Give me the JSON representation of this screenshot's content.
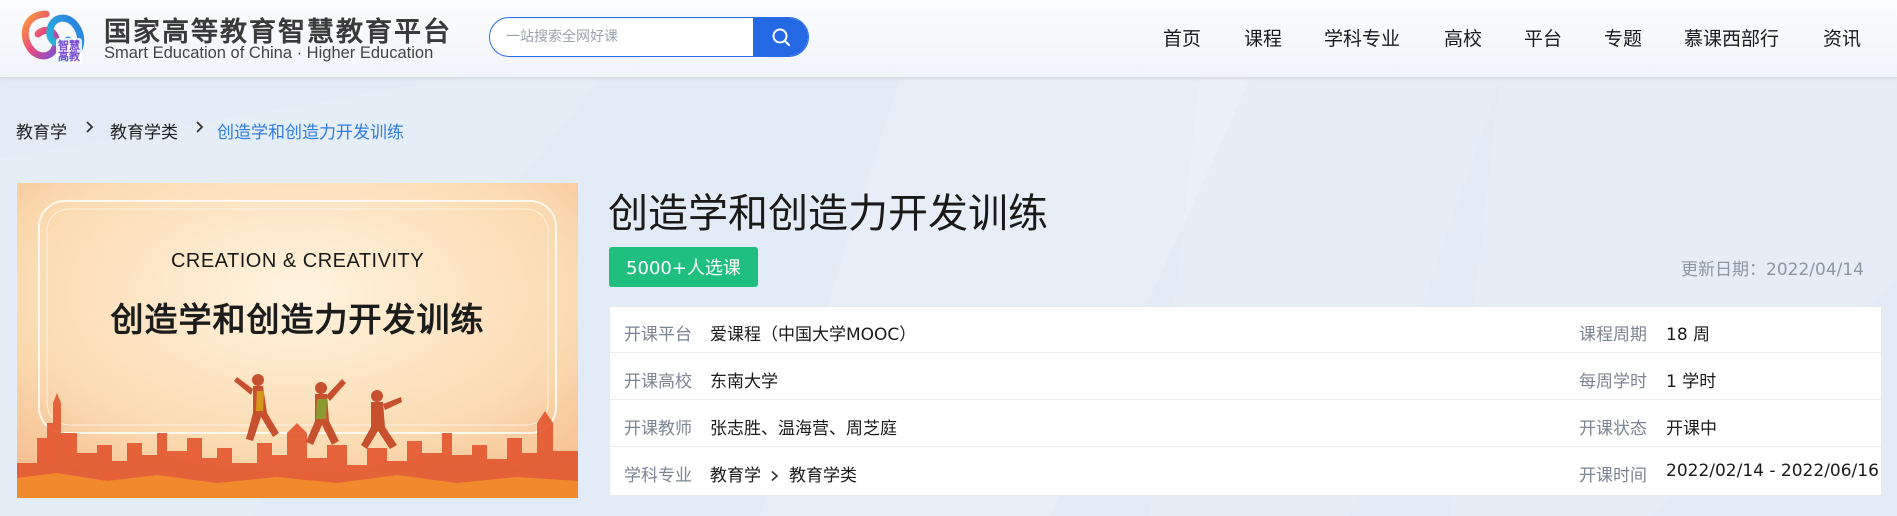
{
  "header": {
    "brand_cn": "国家高等教育智慧教育平台",
    "brand_en": "Smart Education of China · Higher Education",
    "logo_text": "智慧高教",
    "search": {
      "placeholder": "一站搜索全网好课",
      "value": ""
    },
    "nav": [
      "首页",
      "课程",
      "学科专业",
      "高校",
      "平台",
      "专题",
      "慕课西部行",
      "资讯"
    ]
  },
  "breadcrumb": [
    {
      "label": "教育学"
    },
    {
      "label": "教育学类"
    },
    {
      "label": "创造学和创造力开发训练",
      "active": true
    }
  ],
  "cover": {
    "title_en": "CREATION & CREATIVITY",
    "title_cn": "创造学和创造力开发训练"
  },
  "course": {
    "title": "创造学和创造力开发训练",
    "enroll_badge": "5000+人选课",
    "update_date": "更新日期：2022/04/14",
    "info": [
      {
        "label": "开课平台",
        "value": "爱课程（中国大学MOOC）",
        "right_label": "课程周期",
        "right_value": "18 周"
      },
      {
        "label": "开课高校",
        "value": "东南大学",
        "right_label": "每周学时",
        "right_value": "1 学时"
      },
      {
        "label": "开课教师",
        "value": "张志胜、温海营、周芝庭",
        "right_label": "开课状态",
        "right_value": "开课中"
      },
      {
        "label": "学科专业",
        "value_parts": [
          "教育学",
          "教育学类"
        ],
        "right_label": "开课时间",
        "right_value": "2022/02/14 - 2022/06/16"
      }
    ]
  },
  "colors": {
    "accent": "#2468e3",
    "link": "#2f7de1",
    "badge": "#1fbf7f",
    "muted": "#7b8593"
  },
  "icons": {
    "search": "search-icon",
    "chevron": "chevron-right-icon"
  }
}
